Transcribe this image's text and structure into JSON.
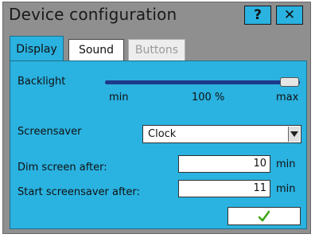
{
  "window": {
    "title": "Device configuration",
    "help_label": "?",
    "close_label": "✕"
  },
  "tabs": [
    {
      "label": "Display",
      "state": "active"
    },
    {
      "label": "Sound",
      "state": "normal"
    },
    {
      "label": "Buttons",
      "state": "disabled"
    }
  ],
  "display": {
    "backlight": {
      "label": "Backlight",
      "min_label": "min",
      "value_label": "100 %",
      "max_label": "max",
      "level": 1.0
    },
    "screensaver": {
      "label": "Screensaver",
      "selected": "Clock"
    },
    "dim_after": {
      "label": "Dim screen after:",
      "value": "10",
      "unit": "min"
    },
    "screensaver_after": {
      "label": "Start screensaver after:",
      "value": "11",
      "unit": "min"
    },
    "ok_icon": "checkmark-icon"
  },
  "colors": {
    "accent": "#2ab2e0",
    "window_bg": "#8f8f8f",
    "check": "#3aa51a"
  }
}
